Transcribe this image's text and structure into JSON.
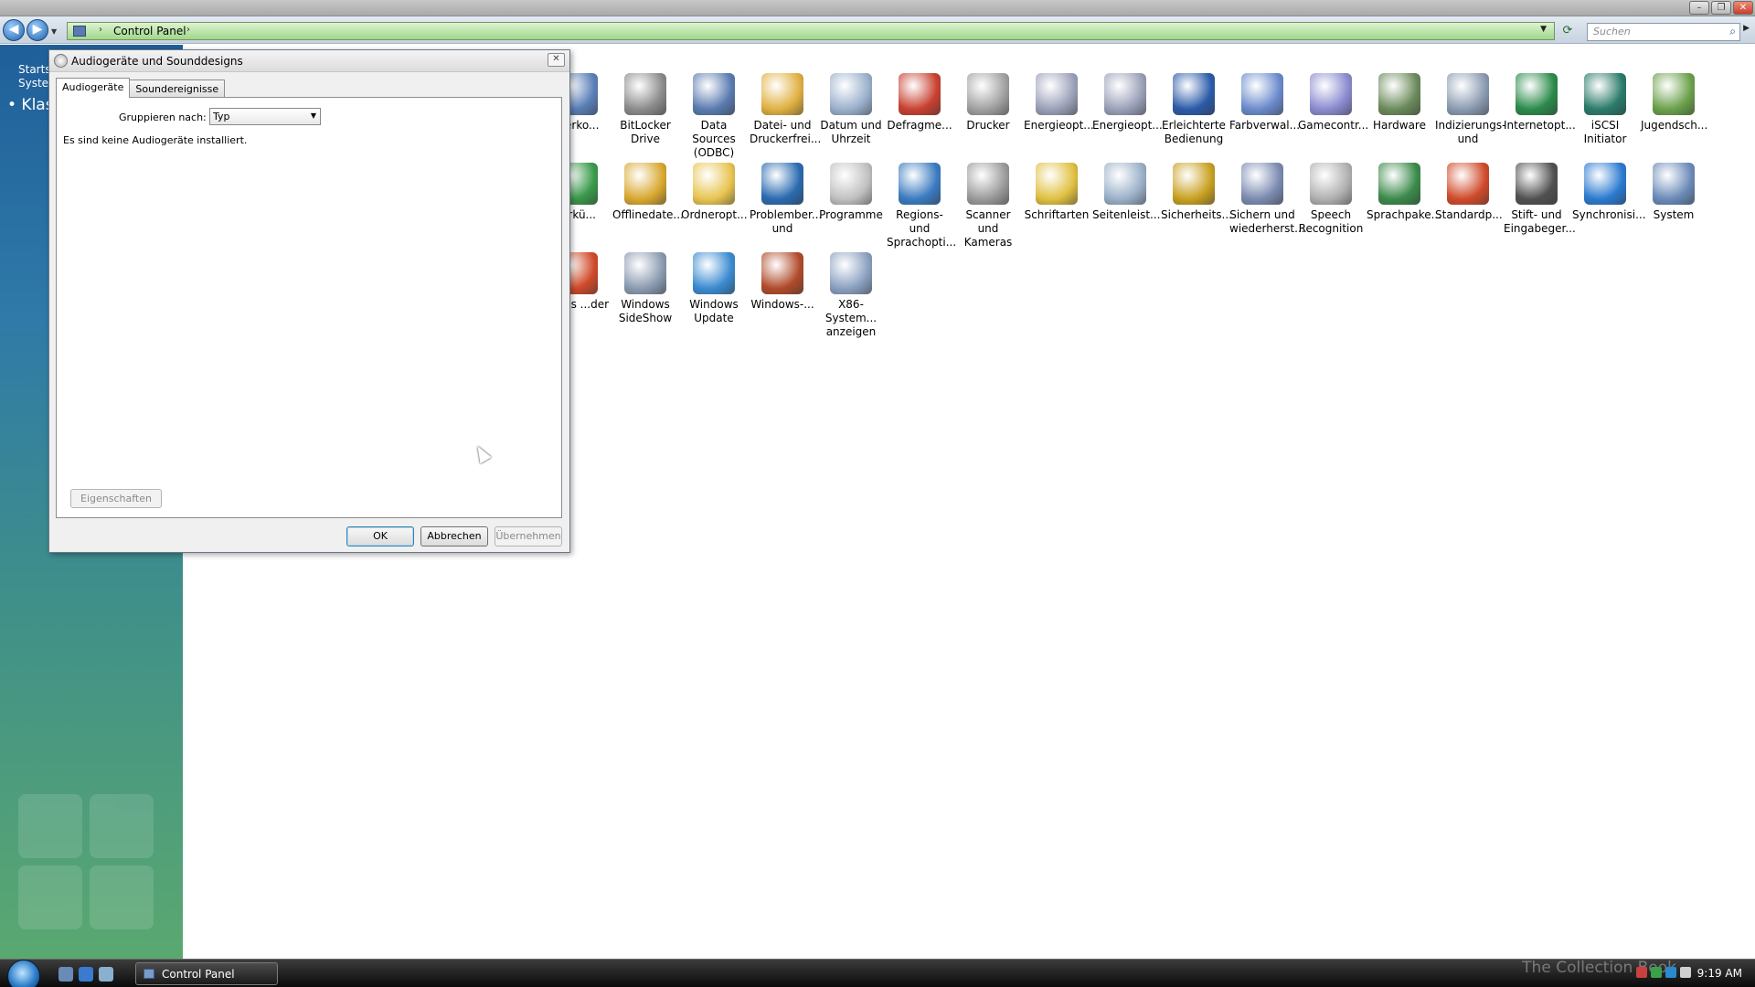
{
  "window": {
    "close_glyph": "✕",
    "minimize_glyph": "–",
    "maximize_glyph": "❐"
  },
  "navbar": {
    "back_glyph": "◀",
    "forward_glyph": "▶",
    "breadcrumb": "Control Panel",
    "search_placeholder": "Suchen"
  },
  "sidebar": {
    "line1": "Startseite der Systemsteuerung",
    "line1_visible": "Startse\nSysten",
    "classic_label": "• Klas"
  },
  "icons": [
    {
      "label": "...erko...",
      "color": "#5a7fb8",
      "icon": "user-icon"
    },
    {
      "label": "BitLocker Drive",
      "color": "#8a8a8a",
      "icon": "bitlocker-icon"
    },
    {
      "label": "Data Sources (ODBC)",
      "color": "#5a7ab0",
      "icon": "odbc-icon"
    },
    {
      "label": "Datei- und Druckerfrei...",
      "color": "#e0b040",
      "icon": "folder-icon"
    },
    {
      "label": "Datum und Uhrzeit",
      "color": "#9ab0cc",
      "icon": "clock-icon"
    },
    {
      "label": "Defragme...",
      "color": "#c84030",
      "icon": "defrag-icon"
    },
    {
      "label": "Drucker",
      "color": "#a0a0a0",
      "icon": "printer-icon"
    },
    {
      "label": "Energieopt...",
      "color": "#9aa0b8",
      "icon": "power-icon"
    },
    {
      "label": "Energieopt...",
      "color": "#9aa0b8",
      "icon": "power-icon"
    },
    {
      "label": "Erleichterte Bedienung",
      "color": "#2a5aa8",
      "icon": "accessibility-icon"
    },
    {
      "label": "Farbverwal...",
      "color": "#6a8acc",
      "icon": "color-icon"
    },
    {
      "label": "Gamecontr...",
      "color": "#8a8ad0",
      "icon": "gamepad-icon"
    },
    {
      "label": "Hardware",
      "color": "#6a8a5a",
      "icon": "hardware-icon"
    },
    {
      "label": "Indizierungs- und",
      "color": "#8a9ab0",
      "icon": "index-icon"
    },
    {
      "label": "Internetopt...",
      "color": "#2a8a4a",
      "icon": "globe-icon"
    },
    {
      "label": "iSCSI Initiator",
      "color": "#2a7a6a",
      "icon": "iscsi-icon"
    },
    {
      "label": "Jugendsch...",
      "color": "#6aa04a",
      "icon": "parental-icon"
    },
    {
      "label": "...rkü...",
      "color": "#3a9a4a",
      "icon": "shortcut-icon"
    },
    {
      "label": "Offlinedate...",
      "color": "#d8a830",
      "icon": "offline-icon"
    },
    {
      "label": "Ordneropt...",
      "color": "#e8c450",
      "icon": "folder-options-icon"
    },
    {
      "label": "Problember... und",
      "color": "#2a6ab0",
      "icon": "problem-icon"
    },
    {
      "label": "Programme",
      "color": "#c0c0c0",
      "icon": "programs-icon"
    },
    {
      "label": "Regions- und Sprachopti...",
      "color": "#3a7ac0",
      "icon": "region-icon"
    },
    {
      "label": "Scanner und Kameras",
      "color": "#9a9a9a",
      "icon": "scanner-icon"
    },
    {
      "label": "Schriftarten",
      "color": "#e0c040",
      "icon": "fonts-icon"
    },
    {
      "label": "Seitenleist...",
      "color": "#9ab0c8",
      "icon": "sidebar-icon"
    },
    {
      "label": "Sicherheits...",
      "color": "#c8a020",
      "icon": "security-icon"
    },
    {
      "label": "Sichern und wiederherst...",
      "color": "#7a8ab0",
      "icon": "backup-icon"
    },
    {
      "label": "Speech Recognition",
      "color": "#b0b0b0",
      "icon": "microphone-icon"
    },
    {
      "label": "Sprachpake...",
      "color": "#3a8a4a",
      "icon": "language-icon"
    },
    {
      "label": "Standardp...",
      "color": "#d04a2a",
      "icon": "default-programs-icon"
    },
    {
      "label": "Stift- und Eingabeger...",
      "color": "#505050",
      "icon": "pen-icon"
    },
    {
      "label": "Synchronisi...",
      "color": "#2a7ad0",
      "icon": "sync-icon"
    },
    {
      "label": "System",
      "color": "#6a8ab8",
      "icon": "system-icon"
    },
    {
      "label": "...ows ...der",
      "color": "#d04a2a",
      "icon": "windows-defender-icon"
    },
    {
      "label": "Windows SideShow",
      "color": "#8a9ab0",
      "icon": "sideshow-icon"
    },
    {
      "label": "Windows Update",
      "color": "#3a8ad0",
      "icon": "windows-update-icon"
    },
    {
      "label": "Windows-...",
      "color": "#b04a2a",
      "icon": "firewall-icon"
    },
    {
      "label": "X86-System... anzeigen",
      "color": "#8aa0c0",
      "icon": "x86-icon"
    }
  ],
  "dialog": {
    "title": "Audiogeräte und Sounddesigns",
    "close_glyph": "✕",
    "tabs": [
      "Audiogeräte",
      "Soundereignisse"
    ],
    "group_label": "Gruppieren nach:",
    "group_value": "Typ",
    "empty_message": "Es sind keine Audiogeräte installiert.",
    "properties_button": "Eigenschaften",
    "ok_button": "OK",
    "cancel_button": "Abbrechen",
    "apply_button": "Übernehmen"
  },
  "taskbar": {
    "task_label": "Control Panel",
    "clock": "9:19 AM",
    "watermark": "The Collection Book"
  }
}
